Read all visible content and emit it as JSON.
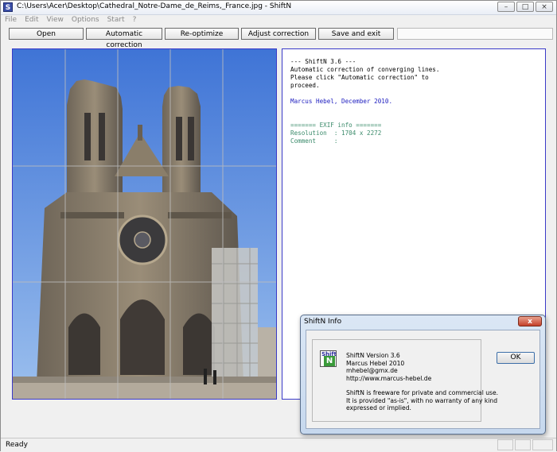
{
  "window": {
    "title": "C:\\Users\\Acer\\Desktop\\Cathedral_Notre-Dame_de_Reims,_France.jpg - ShiftN",
    "app_icon": "S",
    "controls": [
      "minimize-icon",
      "maximize-icon",
      "close-icon"
    ]
  },
  "menu": [
    "File",
    "Edit",
    "View",
    "Options",
    "Start",
    "?"
  ],
  "toolbar": {
    "open": "Open",
    "auto": "Automatic correction",
    "reoptimize": "Re-optimize",
    "adjust": "Adjust correction",
    "save": "Save and exit"
  },
  "info": {
    "lines": [
      {
        "text": "--- ShiftN 3.6 ---",
        "color": "black"
      },
      {
        "text": "Automatic correction of converging lines.",
        "color": "black"
      },
      {
        "text": "Please click \"Automatic correction\" to",
        "color": "black"
      },
      {
        "text": "proceed.",
        "color": "black"
      },
      {
        "text": "",
        "color": "black"
      },
      {
        "text": "Marcus Hebel, December 2010.",
        "color": "blue"
      },
      {
        "text": "",
        "color": "black"
      },
      {
        "text": "",
        "color": "black"
      },
      {
        "text": "======= EXIF info =======",
        "color": "green"
      },
      {
        "text": "Resolution  : 1704 x 2272",
        "color": "green"
      },
      {
        "text": "Comment     :",
        "color": "green"
      }
    ]
  },
  "status": {
    "text": "Ready"
  },
  "dialog": {
    "title": "ShiftN Info",
    "close": "x",
    "logo_top": "Shift",
    "logo_bottom": "N",
    "info1": [
      "ShiftN Version 3.6",
      "Marcus Hebel 2010",
      "mhebel@gmx.de",
      "http://www.marcus-hebel.de"
    ],
    "info2": [
      "ShiftN is freeware for private and commercial use.",
      "It is provided \"as-is\", with no warranty of any kind",
      "expressed or implied."
    ],
    "ok": "OK"
  },
  "colors": {
    "accent_border": "#3a3ac8",
    "info_blue": "#2020c0",
    "info_green": "#3a8a6a",
    "sky": "#5a8fe0"
  }
}
